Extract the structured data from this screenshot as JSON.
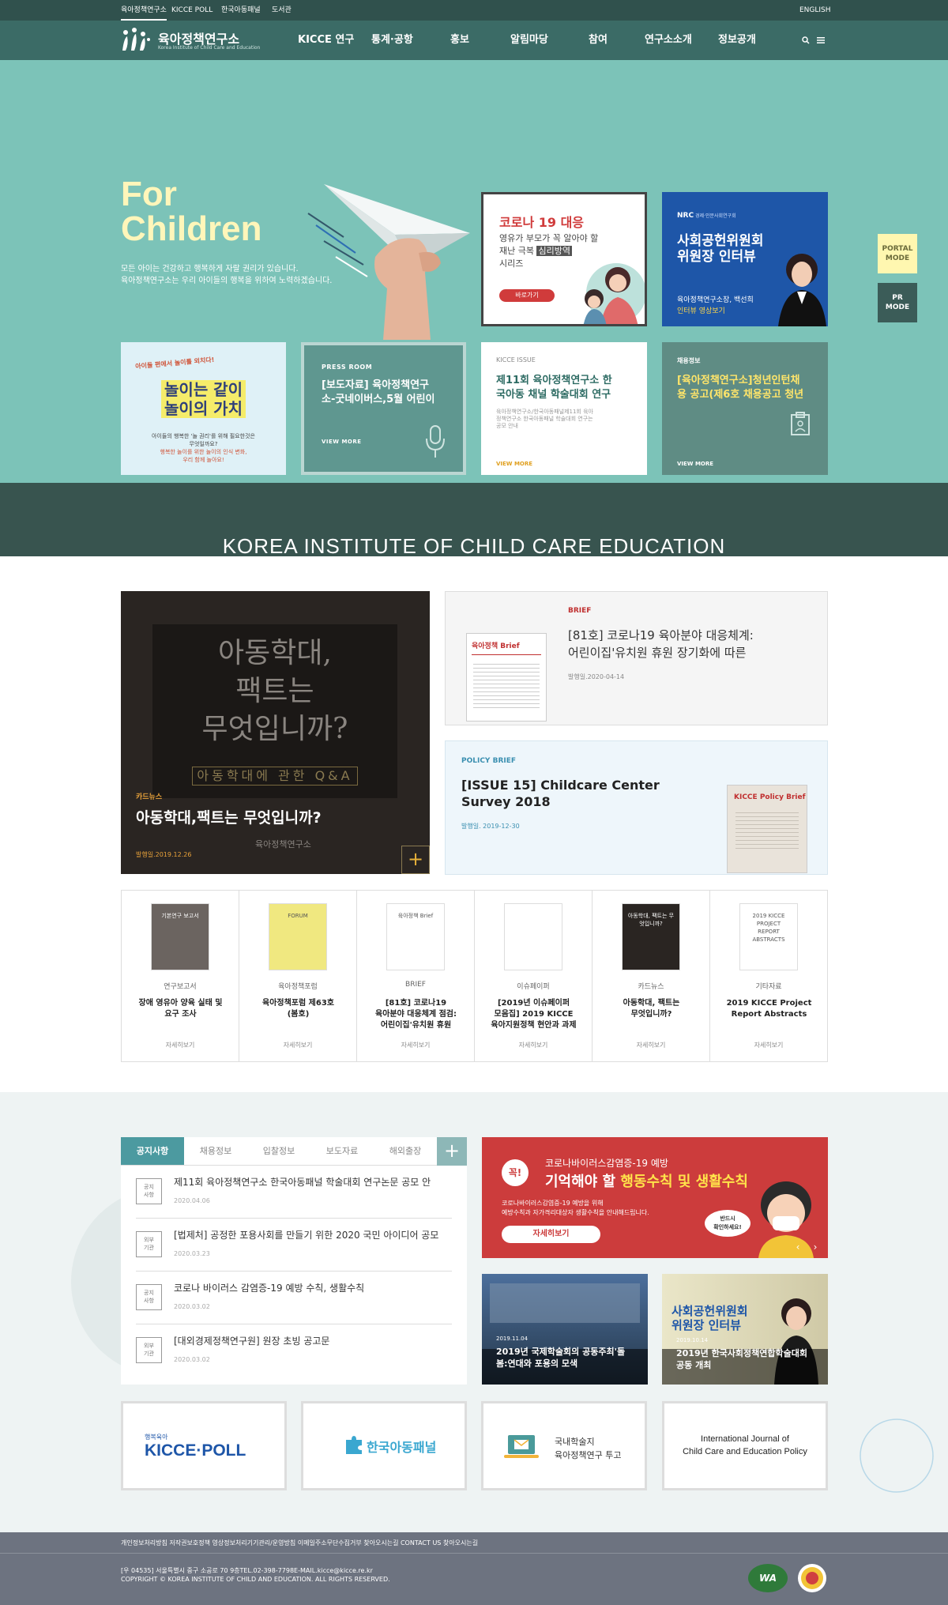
{
  "topbar": {
    "links": [
      "육아정책연구소",
      "KICCE POLL",
      "한국아동패널",
      "도서관"
    ],
    "english": "ENGLISH"
  },
  "logo": {
    "name": "육아정책연구소",
    "sub": "Korea Institute of Child Care and Education"
  },
  "nav": {
    "items": [
      "KICCE 연구",
      "통계·공항",
      "홍보",
      "알림마당",
      "참여",
      "연구소소개",
      "정보공개"
    ]
  },
  "hero": {
    "title_line1": "For",
    "title_line2": "Children",
    "desc_line1": "모든 아이는 건강하고 행복하게 자랄 권리가 있습니다.",
    "desc_line2": "육아정책연구소는 우리 아이들의 행복을 위하여 노력하겠습니다.",
    "card_corona": {
      "title": "코로나 19 대응",
      "line1": "영유가 부모가 꼭 알아야 할",
      "line2a": "재난 극복 ",
      "line2b": "심리방역",
      "line3": "시리즈",
      "button": "바로가기"
    },
    "card_interview": {
      "org": "NRC",
      "org_full": "경제·인문사회연구회",
      "title1": "사회공헌위원회",
      "title2": "위원장 인터뷰",
      "caption1": "육아정책연구소장, 백선희",
      "caption2": "인터뷰 영상보기"
    },
    "card_play": {
      "banner": "아이들 편에서 놀이를 외치다!",
      "big1": "놀이는 같이",
      "big2": "놀이의 가치",
      "desc1": "아이들의 행복한 '놀 권리'를 위해 필요한것은",
      "desc2": "무엇일까요?",
      "desc3": "행복한 놀이를 위한 놀이의 인식 변화,",
      "desc4": "우리 함께 놀아요!"
    },
    "card_press": {
      "label": "PRESS ROOM",
      "title1": "[보도자료] 육아정책연구",
      "title2": "소-굿네이버스,5월 어린이",
      "more": "VIEW MORE"
    },
    "card_issue": {
      "label": "KICCE ISSUE",
      "title1": "제11회 육아정책연구소 한",
      "title2": "국아동 채널 학술대회 연구",
      "desc1": "육아정책연구소/한국아동패널제11회 육아",
      "desc2": "정책연구소 한국아동패널 학술대회 연구는",
      "desc3": "공모 안내",
      "more": "VIEW MORE"
    },
    "card_job": {
      "label": "채용정보",
      "title1": "[육아정책연구소]청년인턴채",
      "title2": "용 공고(제6호 채용공고 청년",
      "more": "VIEW MORE"
    },
    "portal_mode": [
      "PORTAL",
      "MODE"
    ],
    "pr_mode": [
      "PR",
      "MODE"
    ],
    "band_title": "KOREA INSTITUTE OF CHILD CARE EDUCATION"
  },
  "feature": {
    "cardnews": {
      "img_line1": "아동학대,",
      "img_line2": "팩트는",
      "img_line3": "무엇입니까?",
      "img_qa": "아동학대에 관한 Q&A",
      "cat": "카드뉴스",
      "title": "아동학대,팩트는 무엇입니까?",
      "date": "발행일.2019.12.26",
      "logo": "육아정책연구소",
      "plus": "+"
    },
    "brief": {
      "cat": "BRIEF",
      "title1": "[81호] 코로나19 육아분야 대응체계:",
      "title2": "어린이집'유치원 휴원 장기화에 따른",
      "date": "발행일.2020-04-14",
      "thumb": "육아정책 Brief"
    },
    "policy": {
      "cat": "POLICY BRIEF",
      "title1": "[ISSUE 15] Childcare Center",
      "title2": "Survey 2018",
      "date": "발행일. 2019-12-30",
      "thumb": "KICCE Policy Brief"
    }
  },
  "pubs": [
    {
      "cat": "연구보고서",
      "t1": "장애 영유아 양육 실태 및",
      "t2": "요구 조사",
      "t3": "",
      "more": "자세히보기",
      "thumb": "기본연구 보고서"
    },
    {
      "cat": "육아정책포럼",
      "t1": "육아정책포럼 제63호",
      "t2": "(봄호)",
      "t3": "",
      "more": "자세히보기",
      "thumb": "FORUM"
    },
    {
      "cat": "BRIEF",
      "t1": "[81호] 코로나19",
      "t2": "육아분야 대응체계 점검:",
      "t3": "어린이집'유치원 휴원",
      "more": "자세히보기",
      "thumb": "육아정책 Brief"
    },
    {
      "cat": "이슈페이퍼",
      "t1": "[2019년 이슈페이퍼",
      "t2": "모음집] 2019 KICCE",
      "t3": "육아지원정책 현안과 과제",
      "more": "자세히보기",
      "thumb": ""
    },
    {
      "cat": "카드뉴스",
      "t1": "아동학대, 팩트는",
      "t2": "무엇입니까?",
      "t3": "",
      "more": "자세히보기",
      "thumb": "아동학대, 팩트는 무엇입니까?"
    },
    {
      "cat": "기타자료",
      "t1": "2019 KICCE Project",
      "t2": "Report Abstracts",
      "t3": "",
      "more": "자세히보기",
      "thumb": "2019 KICCE PROJECT REPORT ABSTRACTS"
    }
  ],
  "notice_tabs": [
    "공지사항",
    "채용정보",
    "입찰정보",
    "보도자료",
    "해외출장"
  ],
  "notice_plus": "+",
  "notices": [
    {
      "b1": "공지",
      "b2": "사항",
      "title": "제11회 육아정책연구소 한국아동패널 학술대회 연구논문 공모 안",
      "date": "2020.04.06"
    },
    {
      "b1": "외부",
      "b2": "기관",
      "title": "[법제처] 공정한 포용사회를 만들기 위한 2020 국민 아이디어 공모",
      "date": "2020.03.23"
    },
    {
      "b1": "공지",
      "b2": "사항",
      "title": "코로나 바이러스 감염증-19 예방 수칙, 생활수칙",
      "date": "2020.03.02"
    },
    {
      "b1": "외부",
      "b2": "기관",
      "title": "[대외경제정책연구원] 원장 초빙 공고문",
      "date": "2020.03.02"
    }
  ],
  "covid_banner": {
    "badge": "꼭!",
    "line1": "코로나바이러스감염증-19 예방",
    "line2a": "기억해야 할 ",
    "line2b": "행동수칙 및 생활수칙",
    "desc1": "코로나바이러스감염증-19 예방을 위해",
    "desc2": "예방수칙과 자가격리대상자 생활수칙을 안내해드립니다.",
    "button": "자세히보기",
    "bubble1": "반드시",
    "bubble2": "확인하세요!"
  },
  "videos": [
    {
      "date": "2019.11.04",
      "t1": "2019년 국제학술회의 공동주최'돌",
      "t2": "봄:연대와 포용의 모색"
    },
    {
      "date": "2019.10.14",
      "t1": "2019년 한국사회정책연합학술대회",
      "t2": "공동 개최",
      "overlay1": "사회공헌위원회",
      "overlay2": "위원장 인터뷰"
    }
  ],
  "banners": {
    "poll_small": "행복육아",
    "poll": "KICCE·POLL",
    "panel": "한국아동패널",
    "journal1": "국내학술지",
    "journal2": "육아정책연구 투고",
    "ijccep1": "International Journal of",
    "ijccep2": "Child Care and Education Policy"
  },
  "footer": {
    "links": "개인정보처리방침  저작권보호정책  영상정보처리기기관리/운영방침  이메일주소무단수집거부  찾아오시는길  CONTACT US  찾아오시는길",
    "addr": "[우 04535] 서울특별시 중구 소공로 70 9층TEL.02-398-7798E-MAIL.kicce@kicce.re.kr",
    "copy": "COPYRIGHT © KOREA INSTITUTE OF CHILD AND EDUCATION. ALL RIGHTS RESERVED.",
    "wa": "WA"
  },
  "colors": {
    "teal": "#7cc3b8",
    "dark_teal": "#3b6b66",
    "accent_red": "#d03b3b",
    "navy": "#1e56a8"
  }
}
